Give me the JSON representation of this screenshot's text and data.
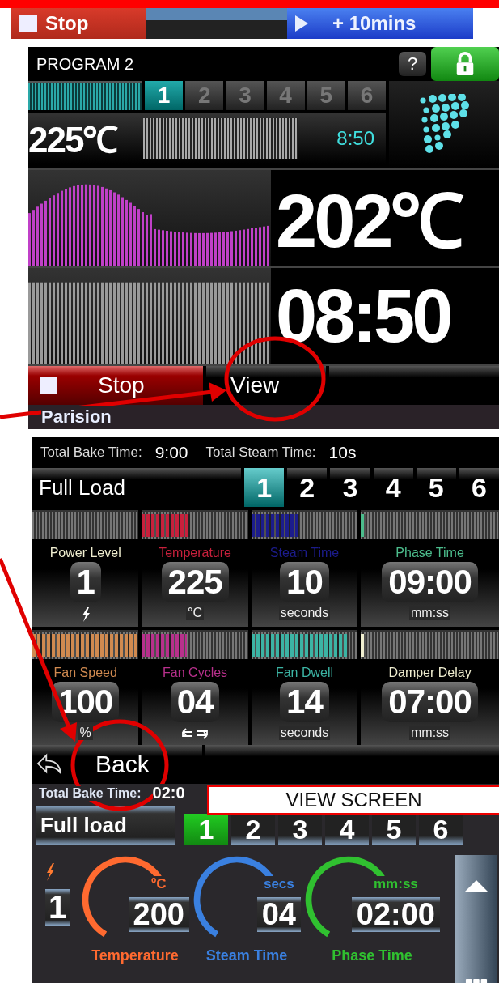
{
  "top_strip": {
    "stop_label": "Stop",
    "extend_label": "+ 10mins"
  },
  "run_screen": {
    "title": "PROGRAM 2",
    "help_label": "?",
    "phases": [
      {
        "label": "1",
        "selected": true
      },
      {
        "label": "2",
        "selected": false
      },
      {
        "label": "3",
        "selected": false
      },
      {
        "label": "4",
        "selected": false
      },
      {
        "label": "5",
        "selected": false
      },
      {
        "label": "6",
        "selected": false
      }
    ],
    "set_temperature": "225℃",
    "phase_time": "8:50",
    "current_temperature": "202℃",
    "remaining_time": "08:50",
    "buttons": [
      {
        "kind": "stop",
        "label": "Stop"
      },
      {
        "kind": "view",
        "label": "View"
      }
    ],
    "program_name": "Parision"
  },
  "view_screen": {
    "total_bake_time_label": "Total Bake Time:",
    "total_bake_time": "9:00",
    "total_steam_time_label": "Total Steam Time:",
    "total_steam_time": "10s",
    "phase_name": "Full Load",
    "phases": [
      {
        "label": "1",
        "selected": true
      },
      {
        "label": "2",
        "selected": false
      },
      {
        "label": "3",
        "selected": false
      },
      {
        "label": "4",
        "selected": false
      },
      {
        "label": "5",
        "selected": false
      },
      {
        "label": "6",
        "selected": false
      }
    ],
    "parameters": [
      {
        "label": "Power Level",
        "value": "1",
        "kind": "power",
        "color": "#f0eed0"
      },
      {
        "label": "Temperature",
        "value": "225",
        "kind": "text",
        "unit": "°C",
        "color": "#c8203c",
        "level": 0.45
      },
      {
        "label": "Steam Time",
        "value": "10",
        "kind": "text",
        "unit": "seconds",
        "color": "#1c1c8c",
        "level": 0.45
      },
      {
        "label": "Phase Time",
        "value": "09:00",
        "kind": "text",
        "unit": "mm:ss",
        "color": "#4cbc8c",
        "level": 0.04
      },
      {
        "label": "Fan Speed",
        "value": "100",
        "kind": "text",
        "unit": "%",
        "color": "#d08a50",
        "level": 1
      },
      {
        "label": "Fan Cycles",
        "value": "04",
        "kind": "cycles",
        "color": "#b8308c",
        "level": 0.42
      },
      {
        "label": "Fan Dwell",
        "value": "14",
        "kind": "text",
        "unit": "seconds",
        "color": "#3cb4a4",
        "level": 0.9
      },
      {
        "label": "Damper Delay",
        "value": "07:00",
        "kind": "text",
        "unit": "mm:ss",
        "color": "#f0eed0",
        "level": 0.04
      }
    ],
    "back_label": "Back"
  },
  "edit_screen": {
    "total_bake_time_label": "Total Bake Time:",
    "total_bake_time": "02:0",
    "phase_name": "Full load",
    "phases": [
      {
        "label": "1",
        "selected": true
      },
      {
        "label": "2",
        "selected": false
      },
      {
        "label": "3",
        "selected": false
      },
      {
        "label": "4",
        "selected": false
      },
      {
        "label": "5",
        "selected": false
      },
      {
        "label": "6",
        "selected": false
      }
    ],
    "power_level": "1",
    "gauges": [
      {
        "label": "Temperature",
        "unit": "ºC",
        "value": "200",
        "color": "#ff6a30"
      },
      {
        "label": "Steam Time",
        "unit": "secs",
        "value": "04",
        "color": "#3a80e0"
      },
      {
        "label": "Phase Time",
        "unit": "mm:ss",
        "value": "02:00",
        "color": "#30c030"
      }
    ]
  },
  "annotation": {
    "label": "VIEW SCREEN"
  }
}
